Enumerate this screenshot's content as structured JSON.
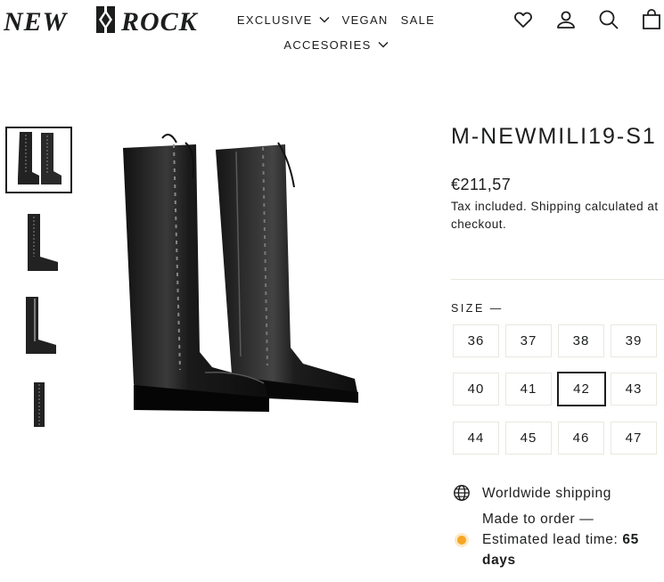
{
  "brand": {
    "logo_text_left": "NEW",
    "logo_text_right": "ROCK"
  },
  "nav": {
    "row1": [
      {
        "label": "EXCLUSIVE",
        "has_dropdown": true
      },
      {
        "label": "VEGAN",
        "has_dropdown": false
      },
      {
        "label": "SALE",
        "has_dropdown": false
      }
    ],
    "row2": [
      {
        "label": "ACCESORIES",
        "has_dropdown": true
      }
    ]
  },
  "header_icons": [
    "heart-icon",
    "account-icon",
    "search-icon",
    "cart-icon"
  ],
  "gallery": {
    "thumbnails": [
      "front-pair",
      "side-right",
      "side-left",
      "back"
    ],
    "active_index": 0
  },
  "product": {
    "title": "M-NEWMILI19-S1",
    "price": "€211,57",
    "tax_note": "Tax included. Shipping calculated at checkout."
  },
  "size": {
    "label": "SIZE —",
    "options": [
      "36",
      "37",
      "38",
      "39",
      "40",
      "41",
      "42",
      "43",
      "44",
      "45",
      "46",
      "47"
    ],
    "selected": "42"
  },
  "shipping": {
    "worldwide": "Worldwide shipping",
    "made_to_order": "Made to order —",
    "lead_time_label": "Estimated lead time:",
    "lead_time_value": "65 days"
  },
  "colors": {
    "text": "#1c1d1d",
    "border": "#e8e8e1",
    "status_dot": "#f5a623"
  }
}
